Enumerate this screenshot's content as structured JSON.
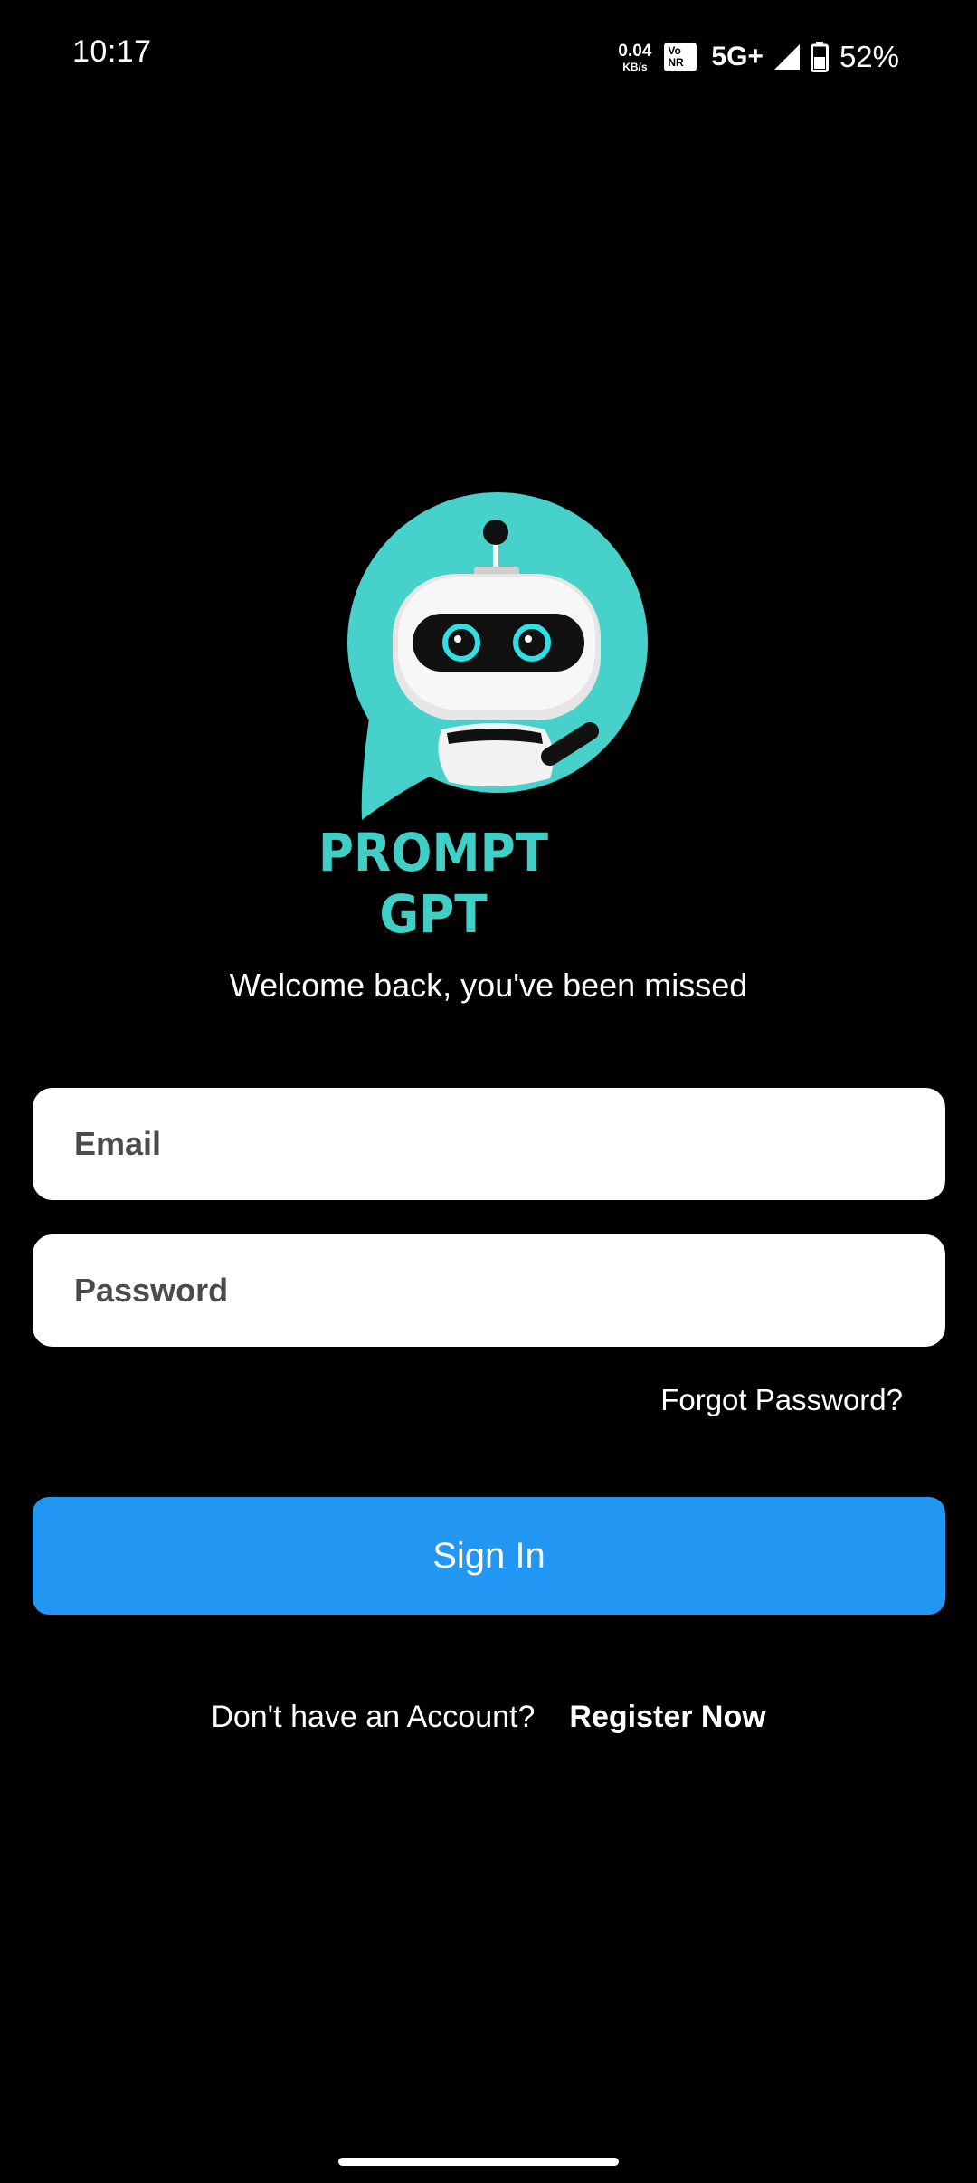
{
  "status_bar": {
    "time": "10:17",
    "net_speed_value": "0.04",
    "net_speed_unit": "KB/s",
    "volte_top": "Vo",
    "volte_bottom": "NR",
    "network_type": "5G+",
    "battery_percent": "52%",
    "icons": [
      "volte-icon",
      "signal-icon",
      "battery-icon"
    ]
  },
  "logo": {
    "text": "PROMPT GPT",
    "colors": {
      "bubble": "#46d1ca",
      "text": "#3fcfc6",
      "eyes": "#2ee0e6"
    }
  },
  "login": {
    "welcome": "Welcome back, you've been missed",
    "email_placeholder": "Email",
    "password_placeholder": "Password",
    "forgot_password": "Forgot Password?",
    "sign_in": "Sign In",
    "no_account": "Don't have an Account?",
    "register": "Register Now"
  },
  "colors": {
    "background": "#000000",
    "primary_button": "#2196f3",
    "input_background": "#ffffff"
  }
}
